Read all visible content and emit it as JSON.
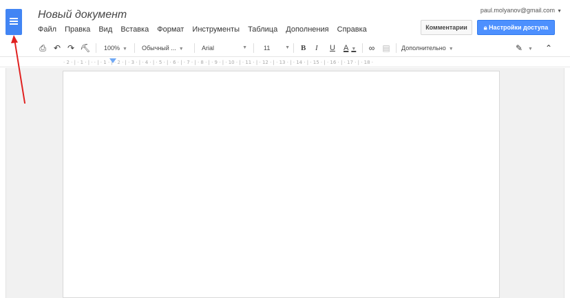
{
  "header": {
    "doc_title": "Новый документ",
    "account_email": "paul.molyanov@gmail.com",
    "comments_label": "Комментарии",
    "share_label": "Настройки доступа"
  },
  "menu": {
    "items": [
      "Файл",
      "Правка",
      "Вид",
      "Вставка",
      "Формат",
      "Инструменты",
      "Таблица",
      "Дополнения",
      "Справка"
    ]
  },
  "toolbar": {
    "zoom": "100%",
    "style": "Обычный ...",
    "font": "Arial",
    "size": "11",
    "bold": "B",
    "italic": "I",
    "underline": "U",
    "text_color": "A",
    "more": "Дополнительно"
  },
  "ruler": {
    "ticks": "· 2 · | · 1 · | · · | · 1 · | · 2 · | · 3 · | · 4 · | · 5 · | · 6 · | · 7 · | · 8 · | · 9 · | · 10 · | · 11 · | · 12 · | · 13 · | · 14 · | · 15 · | · 16 · | · 17 · | · 18 ·"
  },
  "colors": {
    "logo_blue": "#4285f4",
    "share_button": "#4d90fe",
    "annotation_arrow": "#e0201f"
  },
  "icons": [
    "docs-logo-icon",
    "print-icon",
    "undo-icon",
    "redo-icon",
    "paint-format-icon",
    "link-icon",
    "comment-icon",
    "pen-icon",
    "collapse-icon",
    "lock-icon",
    "dropdown-caret-icon"
  ]
}
